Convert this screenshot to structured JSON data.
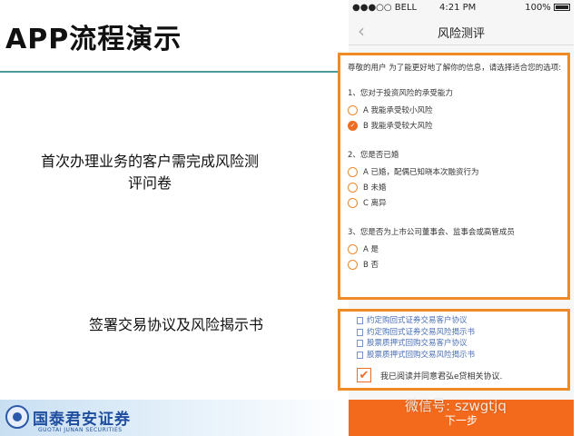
{
  "slide": {
    "title": "APP流程演示",
    "caption_1": "首次办理业务的客户需完成风险测评问卷",
    "caption_2": "签署交易协议及风险揭示书"
  },
  "status_bar": {
    "carrier": "●●●○○ BELL",
    "time": "4:21 PM",
    "battery": "100%"
  },
  "nav": {
    "back": "‹",
    "title": "风险测评"
  },
  "form": {
    "intro": "尊敬的用户 为了能更好地了解你的信息，请选择适合您的选项:",
    "questions": [
      {
        "text": "1、您对于投资风险的承受能力",
        "options": [
          {
            "label": "A 我能承受较小风险",
            "selected": false
          },
          {
            "label": "B 我能承受较大风险",
            "selected": true
          }
        ]
      },
      {
        "text": "2、您是否已婚",
        "options": [
          {
            "label": "A 已婚，配偶已知晓本次融资行为",
            "selected": false
          },
          {
            "label": "B 未婚",
            "selected": false
          },
          {
            "label": "C 离异",
            "selected": false
          }
        ]
      },
      {
        "text": "3、您是否为上市公司董事会、监事会或高管成员",
        "options": [
          {
            "label": "A 是",
            "selected": false
          },
          {
            "label": "B 否",
            "selected": false
          }
        ]
      }
    ]
  },
  "agreements": {
    "documents": [
      "约定购回式证券交易客户协议",
      "约定购回式证券交易风险揭示书",
      "股票质押式回购交易客户协议",
      "股票质押式回购交易风险揭示书"
    ],
    "consent": "我已阅读并同意君弘e贷相关协议.",
    "checked": true
  },
  "next_button": "下一步",
  "watermark": "微信号: szwgtjq",
  "logo": {
    "cn": "国泰君安证券",
    "en": "GUOTAI JUNAN SECURITIES"
  },
  "colors": {
    "accent": "#ef8a24",
    "button": "#f46a1c",
    "link": "#4a6fb4"
  }
}
